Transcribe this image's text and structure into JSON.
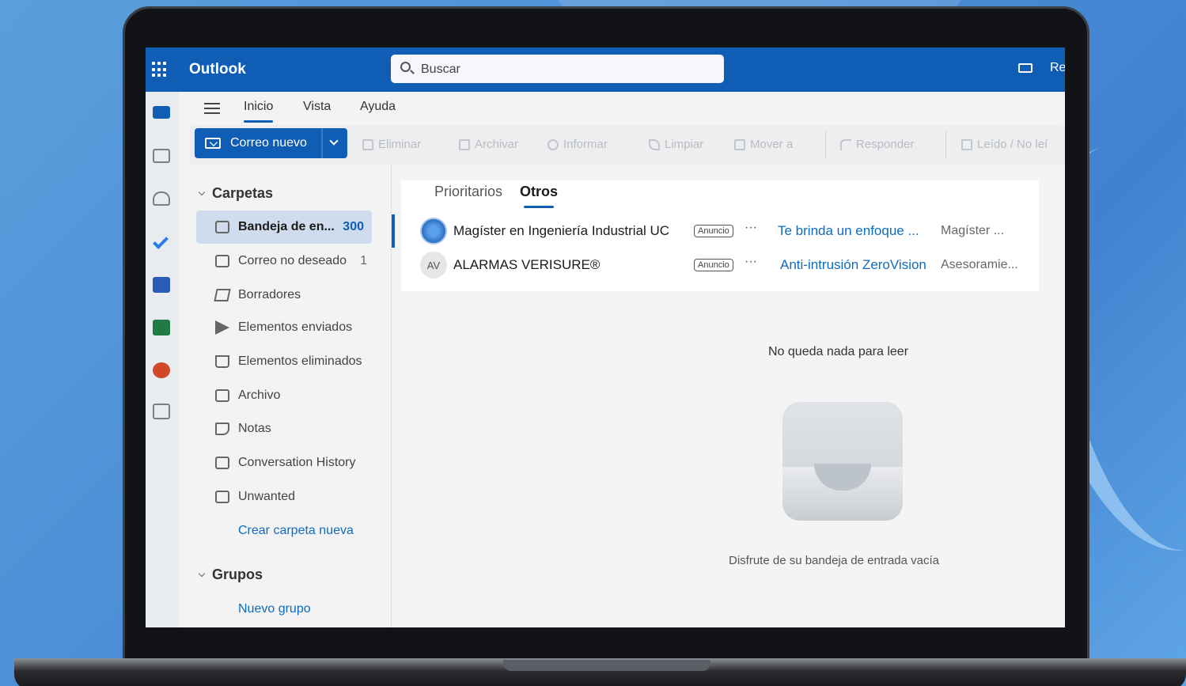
{
  "app": {
    "title": "Outlook",
    "search_placeholder": "Buscar",
    "top_right_text": "Re"
  },
  "menu": {
    "tabs": [
      "Inicio",
      "Vista",
      "Ayuda"
    ],
    "active_tab": "Inicio"
  },
  "toolbar": {
    "new_mail_label": "Correo nuevo",
    "actions": [
      "Eliminar",
      "Archivar",
      "Informar",
      "Limpiar",
      "Mover a",
      "Responder",
      "Leído / No leí"
    ]
  },
  "folders": {
    "section_title": "Carpetas",
    "items": [
      {
        "name": "Bandeja de en...",
        "count": "300",
        "icon": "inbox-icon",
        "selected": true
      },
      {
        "name": "Correo no deseado",
        "count": "1",
        "icon": "junk-icon",
        "selected": false
      },
      {
        "name": "Borradores",
        "count": "",
        "icon": "draft-icon",
        "selected": false
      },
      {
        "name": "Elementos enviados",
        "count": "",
        "icon": "send-icon",
        "selected": false
      },
      {
        "name": "Elementos eliminados",
        "count": "",
        "icon": "trash-icon",
        "selected": false
      },
      {
        "name": "Archivo",
        "count": "",
        "icon": "archive-icon",
        "selected": false
      },
      {
        "name": "Notas",
        "count": "",
        "icon": "note-icon",
        "selected": false
      },
      {
        "name": "Conversation History",
        "count": "",
        "icon": "folder-icon",
        "selected": false
      },
      {
        "name": "Unwanted",
        "count": "",
        "icon": "folder-icon",
        "selected": false
      }
    ],
    "create_folder_link": "Crear carpeta nueva",
    "groups_title": "Grupos",
    "new_group_link": "Nuevo grupo"
  },
  "message_list": {
    "tabs": [
      "Prioritarios",
      "Otros"
    ],
    "active_tab": "Otros",
    "messages": [
      {
        "sender": "Magíster en Ingeniería Industrial UC",
        "badge": "Anuncio",
        "subject": "Te brinda un enfoque ...",
        "preview": "Magíster ...",
        "avatar": "seal"
      },
      {
        "sender": "ALARMAS VERISURE®",
        "badge": "Anuncio",
        "subject": "Anti-intrusión ZeroVision",
        "preview": "Asesoramie...",
        "avatar": "AV"
      }
    ],
    "empty_title": "No queda nada para leer",
    "empty_subtitle": "Disfrute de su bandeja de entrada vacía"
  },
  "colors": {
    "brand": "#0f5db5",
    "link": "#0f6cbd",
    "selected_folder_bg": "#cfdced"
  }
}
